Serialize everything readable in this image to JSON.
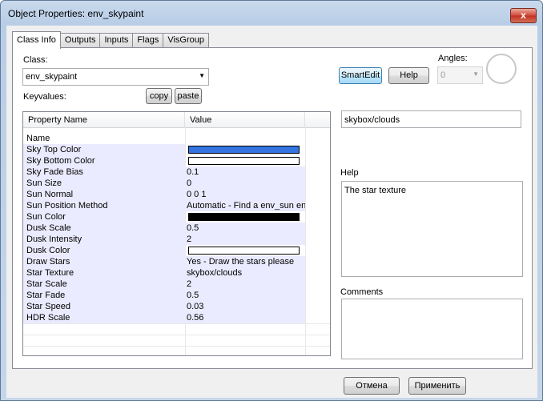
{
  "window": {
    "title": "Object Properties: env_skypaint",
    "close": "x"
  },
  "tabs": [
    "Class Info",
    "Outputs",
    "Inputs",
    "Flags",
    "VisGroup"
  ],
  "class_section": {
    "label": "Class:",
    "value": "env_skypaint",
    "keyvalues_label": "Keyvalues:"
  },
  "buttons": {
    "copy": "copy",
    "paste": "paste",
    "smartedit": "SmartEdit",
    "help": "Help",
    "cancel": "Отмена",
    "apply": "Применить"
  },
  "angles": {
    "label": "Angles:",
    "value": "0"
  },
  "table": {
    "headers": [
      "Property Name",
      "Value"
    ],
    "rows": [
      {
        "name": "Name",
        "value": ""
      },
      {
        "name": "Sky Top Color",
        "value": "",
        "color": "#3374e0"
      },
      {
        "name": "Sky Bottom Color",
        "value": "",
        "color": "#ffffff"
      },
      {
        "name": "Sky Fade Bias",
        "value": "0.1"
      },
      {
        "name": "Sun Size",
        "value": "0"
      },
      {
        "name": "Sun Normal",
        "value": "0 0 1"
      },
      {
        "name": "Sun Position Method",
        "value": "Automatic - Find a env_sun ent"
      },
      {
        "name": "Sun Color",
        "value": "",
        "color": "#000000"
      },
      {
        "name": "Dusk Scale",
        "value": "0.5"
      },
      {
        "name": "Dusk Intensity",
        "value": "2"
      },
      {
        "name": "Dusk Color",
        "value": "",
        "color": "#ffffff"
      },
      {
        "name": "Draw Stars",
        "value": "Yes - Draw the stars please"
      },
      {
        "name": "Star Texture",
        "value": "skybox/clouds"
      },
      {
        "name": "Star Scale",
        "value": "2"
      },
      {
        "name": "Star Fade",
        "value": "0.5"
      },
      {
        "name": "Star Speed",
        "value": "0.03"
      },
      {
        "name": "HDR Scale",
        "value": "0.56"
      }
    ]
  },
  "right_panel": {
    "edit_value": "skybox/clouds",
    "help_label": "Help",
    "help_text": "The star texture",
    "comments_label": "Comments",
    "comments_text": ""
  }
}
